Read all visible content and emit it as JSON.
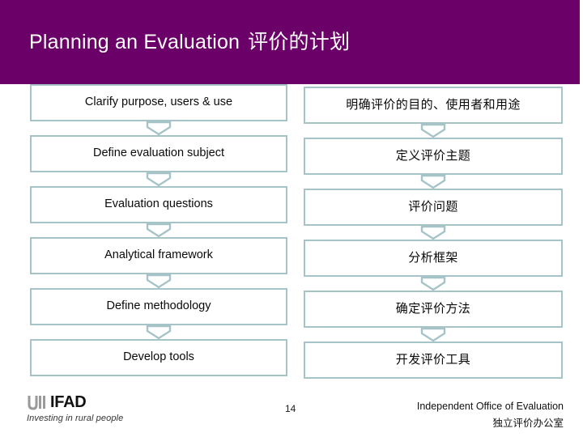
{
  "slide": {
    "title_en": "Planning an Evaluation",
    "title_zh": "评价的计划",
    "header_color": "#6b0069",
    "box_border_color": "#a6c3c8",
    "connector_color": "#a6c3c8"
  },
  "flow": {
    "english_steps": [
      {
        "label": "Clarify purpose, users & use"
      },
      {
        "label": "Define evaluation subject"
      },
      {
        "label": "Evaluation questions"
      },
      {
        "label": "Analytical framework"
      },
      {
        "label": "Define methodology"
      },
      {
        "label": "Develop tools"
      }
    ],
    "chinese_steps": [
      {
        "label": "明确评价的目的、使用者和用途"
      },
      {
        "label": "定义评价主题"
      },
      {
        "label": "评价问题"
      },
      {
        "label": "分析框架"
      },
      {
        "label": "确定评价方法"
      },
      {
        "label": "开发评价工具"
      }
    ]
  },
  "footer": {
    "logo_wordmark": "IFAD",
    "logo_tagline": "Investing in rural people",
    "page_number": "14",
    "office_en": "Independent Office of Evaluation",
    "office_zh": "独立评价办公室"
  }
}
